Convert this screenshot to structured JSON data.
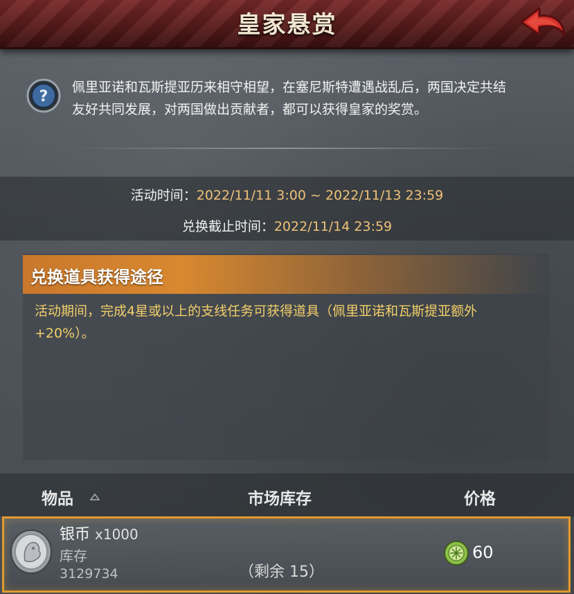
{
  "header": {
    "title": "皇家悬赏"
  },
  "intro": {
    "description": "佩里亚诺和瓦斯提亚历来相守相望，在塞尼斯特遭遇战乱后，两国决定共结友好共同发展，对两国做出贡献者，都可以获得皇家的奖赏。"
  },
  "times": {
    "event_label": "活动时间：",
    "event_value": "2022/11/11 3:00 ~ 2022/11/13 23:59",
    "exchange_label": "兑换截止时间：",
    "exchange_value": "2022/11/14 23:59"
  },
  "section": {
    "title": "兑换道具获得途径",
    "body": "活动期间，完成4星或以上的支线任务可获得道具（佩里亚诺和瓦斯提亚额外+20%）。"
  },
  "table": {
    "col_item": "物品",
    "col_stock": "市场库存",
    "col_price": "价格"
  },
  "row": {
    "name": "银币",
    "qty": "x1000",
    "stock_label": "库存",
    "stock_value": "3129734",
    "remaining": "（剩余 15）",
    "price": "60"
  },
  "colors": {
    "accent": "#e39a2e",
    "header": "#5a1c1c",
    "highlight": "#f3cf6a"
  },
  "icons": [
    "back-arrow-icon",
    "help-icon",
    "sort-asc-icon",
    "silver-coin-icon",
    "price-currency-icon"
  ]
}
